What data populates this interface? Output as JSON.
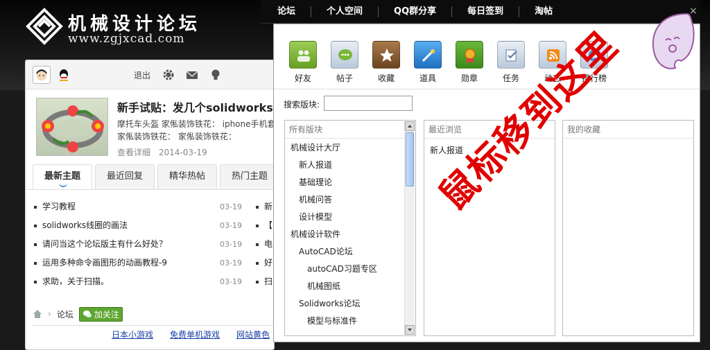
{
  "logo": {
    "title": "机械设计论坛",
    "url": "www.zgjxcad.com"
  },
  "topnav": {
    "items": [
      "论坛",
      "个人空间",
      "QQ群分享",
      "每日签到",
      "淘帖"
    ],
    "close": "×"
  },
  "userbar": {
    "logout": "退出"
  },
  "featured_post": {
    "title": "新手试贴：发几个solidworks做",
    "line1": "摩托车头盔  家俬装饰铁花：  iphone手机套",
    "line2": "家俬装饰铁花：  家俬装饰铁花：",
    "view_detail": "查看详细",
    "date": "2014-03-19"
  },
  "tabs": [
    "最新主题",
    "最近回复",
    "精华热帖",
    "热门主题"
  ],
  "threads": [
    {
      "title": "学习教程",
      "date": "03-19"
    },
    {
      "title": "solidworks线圈的画法",
      "date": "03-19"
    },
    {
      "title": "请问当这个论坛版主有什么好处？",
      "date": "03-19"
    },
    {
      "title": "运用多种命令画图形的动画教程-9",
      "date": "03-19"
    },
    {
      "title": "求助，关于扫描。",
      "date": "03-19"
    }
  ],
  "threads_right": [
    "新",
    "【",
    "电",
    "好",
    "扫"
  ],
  "breadcrumb": {
    "forum": "论坛",
    "follow": "加关注"
  },
  "footer_links": [
    "日本小游戏",
    "免费单机游戏",
    "网站黄色"
  ],
  "popup": {
    "icons": [
      {
        "label": "好友",
        "icon": "friends-icon",
        "color": "#7fb23a"
      },
      {
        "label": "帖子",
        "icon": "chat-icon",
        "color": "#78a6d4"
      },
      {
        "label": "收藏",
        "icon": "star-icon",
        "color": "#a07040"
      },
      {
        "label": "道具",
        "icon": "wand-icon",
        "color": "#3d8fd8"
      },
      {
        "label": "勋章",
        "icon": "medal-icon",
        "color": "#5aa02c"
      },
      {
        "label": "任务",
        "icon": "task-icon",
        "color": "#b9c8dc"
      },
      {
        "label": "动态",
        "icon": "rss-icon",
        "color": "#b8c9e0"
      },
      {
        "label": "排行榜",
        "icon": "rank-icon",
        "color": "#b0c4e2"
      }
    ],
    "search_label": "搜索版块:",
    "columns": {
      "all": "所有版块",
      "recent": "最近浏览",
      "favorites": "我的收藏"
    },
    "forums": [
      {
        "name": "机械设计大厅",
        "level": 0
      },
      {
        "name": "新人报道",
        "level": 1
      },
      {
        "name": "基础理论",
        "level": 1
      },
      {
        "name": "机械问答",
        "level": 1
      },
      {
        "name": "设计模型",
        "level": 1
      },
      {
        "name": "机械设计软件",
        "level": 0
      },
      {
        "name": "AutoCAD论坛",
        "level": 1
      },
      {
        "name": "autoCAD习题专区",
        "level": 2
      },
      {
        "name": "机械图纸",
        "level": 2
      },
      {
        "name": "Solidworks论坛",
        "level": 1
      },
      {
        "name": "模型与标准件",
        "level": 2
      }
    ],
    "recent_items": [
      "新人报道"
    ]
  },
  "watermark": "鼠标移到这里",
  "colors": {
    "header_bg": "#111111",
    "watermark": "#e10000",
    "follow_button": "#5ea631",
    "link": "#1a3ea8"
  }
}
